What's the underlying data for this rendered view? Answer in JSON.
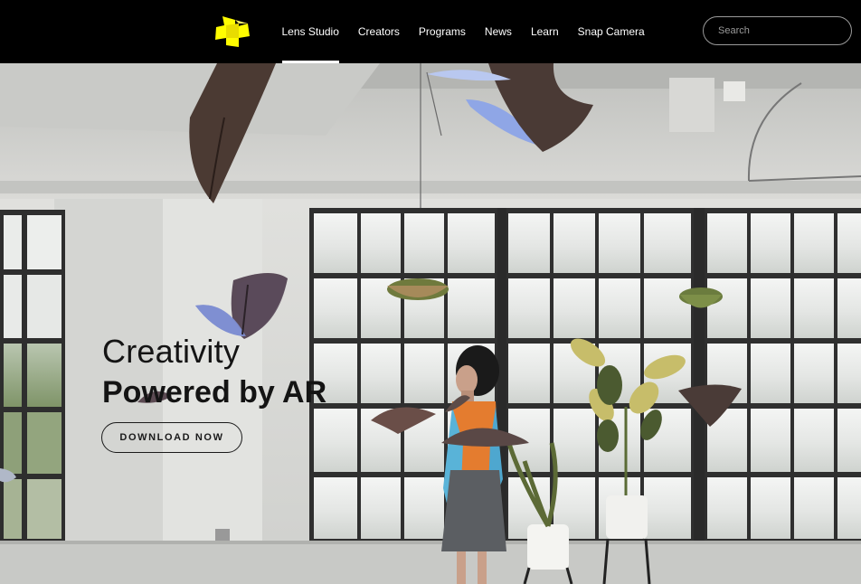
{
  "nav": {
    "logo": "snap-ghost-logo",
    "items": [
      {
        "label": "Lens Studio",
        "active": true
      },
      {
        "label": "Creators",
        "active": false
      },
      {
        "label": "Programs",
        "active": false
      },
      {
        "label": "News",
        "active": false
      },
      {
        "label": "Learn",
        "active": false
      },
      {
        "label": "Snap Camera",
        "active": false
      }
    ],
    "search": {
      "placeholder": "Search",
      "value": ""
    }
  },
  "hero": {
    "title_line1": "Creativity",
    "title_line2": "Powered by AR",
    "cta_label": "DOWNLOAD NOW"
  },
  "colors": {
    "nav_bg": "#000000",
    "logo_yellow": "#FFFC00",
    "text_dark": "#141414"
  }
}
